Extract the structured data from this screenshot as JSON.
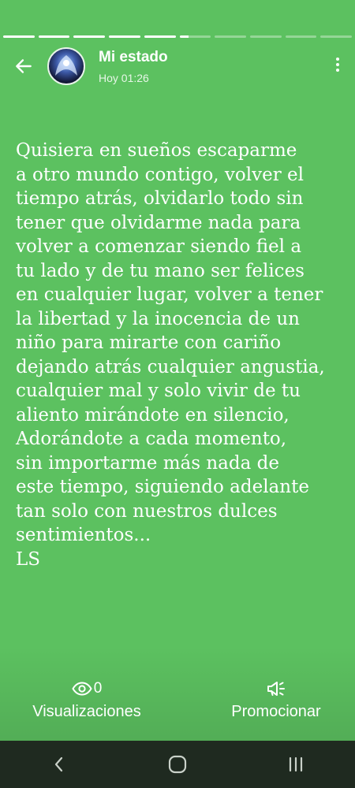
{
  "story": {
    "segments_total": 10,
    "segments_done": 5,
    "current_progress": 0.3
  },
  "header": {
    "title": "Mi estado",
    "time": "Hoy 01:26"
  },
  "status": {
    "lines": [
      "Quisiera en sueños escaparme",
      "a otro mundo contigo, volver el",
      "tiempo atrás, olvidarlo todo sin",
      "tener que olvidarme nada para",
      "volver a comenzar siendo fiel a",
      "tu lado y de tu mano ser felices",
      "en cualquier lugar, volver a tener",
      "la libertad y la inocencia de un",
      "niño para mirarte con cariño",
      "dejando atrás cualquier angustia,",
      "cualquier mal y solo vivir de tu",
      "aliento mirándote en silencio,",
      "Adorándote a cada momento,",
      "sin importarme más nada de",
      "este tiempo, siguiendo adelante",
      "tan solo con nuestros dulces",
      "sentimientos...",
      "LS"
    ]
  },
  "footer": {
    "views_count": "0",
    "views_label": "Visualizaciones",
    "promote_label": "Promocionar"
  },
  "colors": {
    "background": "#5cc160",
    "navbar": "#1f2a20"
  },
  "icons": {
    "back": "arrow-left-icon",
    "more": "more-vertical-icon",
    "views": "eye-icon",
    "promote": "megaphone-icon",
    "nav_back": "chevron-left-icon",
    "nav_home": "home-circle-icon",
    "nav_recents": "recents-icon"
  }
}
